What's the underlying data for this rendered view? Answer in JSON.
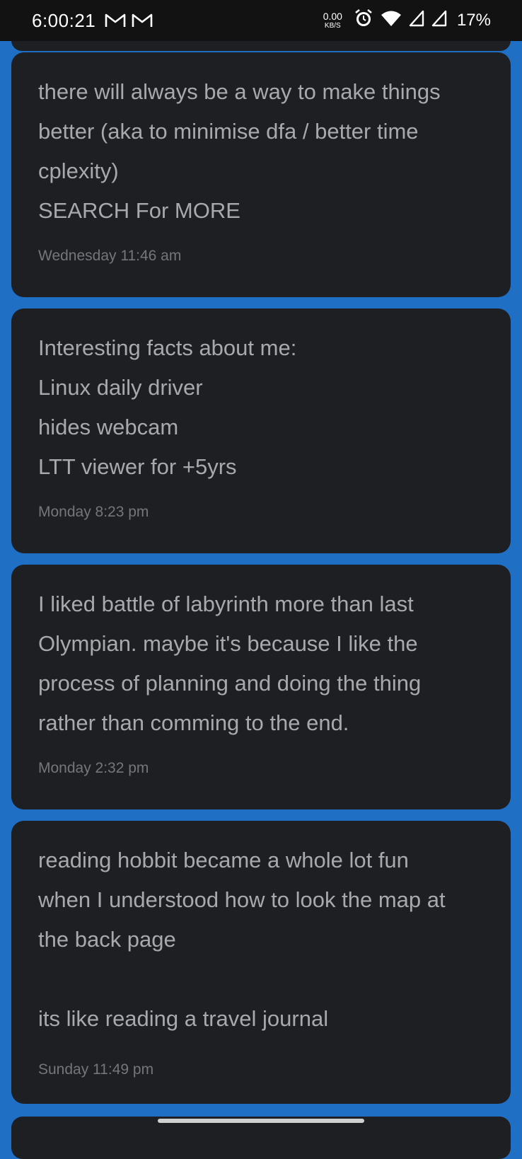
{
  "status_bar": {
    "time": "6:00:21",
    "notification_icons": [
      "gmail-icon",
      "gmail-icon"
    ],
    "net_speed_value": "0.00",
    "net_speed_unit": "KB/S",
    "alarm_icon": "alarm-icon",
    "wifi_icon": "wifi-icon",
    "signal_icons": [
      "cell-signal-icon",
      "cell-signal-icon"
    ],
    "battery": "17%"
  },
  "notes": [
    {
      "lines": [
        "there will always be a way to make things",
        "better (aka to minimise dfa / better time",
        "cplexity)",
        "SEARCH For MORE"
      ],
      "timestamp": "Wednesday 11:46 am"
    },
    {
      "lines": [
        "Interesting facts about me:",
        "Linux daily driver",
        "hides webcam",
        "LTT viewer for +5yrs"
      ],
      "timestamp": "Monday 8:23 pm"
    },
    {
      "lines": [
        "I liked battle of labyrinth more than last",
        "Olympian. maybe it's because I like the",
        "process of planning and doing the thing",
        "rather than comming to the end."
      ],
      "timestamp": "Monday 2:32 pm"
    },
    {
      "lines": [
        "reading hobbit became a whole lot fun",
        "when I understood how to look the map at",
        "the back page",
        "",
        "its like reading a travel journal"
      ],
      "timestamp": "Sunday 11:49 pm"
    }
  ],
  "colors": {
    "background": "#1f6fc4",
    "card": "#1e1f22",
    "text": "#a7a9ad",
    "timestamp": "#73767b"
  }
}
